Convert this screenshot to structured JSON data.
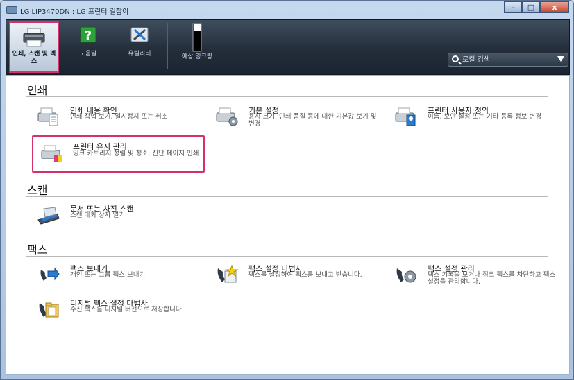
{
  "window": {
    "title": "LG LIP3470DN : LG 프린터 길잡이",
    "controls": {
      "minimize": "–",
      "maximize": "□",
      "close": "x"
    }
  },
  "toolbar": {
    "items": [
      {
        "label": "인쇄, 스캔 및 팩스",
        "icon": "printer-icon",
        "selected": true
      },
      {
        "label": "도움말",
        "icon": "help-icon",
        "selected": false
      },
      {
        "label": "유틸리티",
        "icon": "tools-icon",
        "selected": false
      },
      {
        "label": "예상 잉크량",
        "icon": "ink-level-icon",
        "selected": false
      }
    ],
    "search_placeholder": "로컬 검색"
  },
  "sections": {
    "print": {
      "title": "인쇄",
      "items": [
        {
          "name": "인쇄 내용 확인",
          "desc": "인쇄 작업 보기, 일시정지 또는 취소"
        },
        {
          "name": "기본 설정",
          "desc": "용지 크기, 인쇄 품질 등에 대한 기본값 보기 및 변경"
        },
        {
          "name": "프린터 사용자 정의",
          "desc": "이름, 보안 설정 또는 기타 등록 정보 변경"
        },
        {
          "name": "프린터 유지 관리",
          "desc": "잉크 카트리지 정렬 및 청소, 진단 페이지 인쇄"
        }
      ]
    },
    "scan": {
      "title": "스캔",
      "items": [
        {
          "name": "문서 또는 사진 스캔",
          "desc": "스캔 대화 상자 열기"
        }
      ]
    },
    "fax": {
      "title": "팩스",
      "items": [
        {
          "name": "팩스 보내기",
          "desc": "개인 또는 그룹 팩스 보내기"
        },
        {
          "name": "팩스 설정 마법사",
          "desc": "팩스를 설정하여 팩스를 보내고 받습니다."
        },
        {
          "name": "팩스 설정 관리",
          "desc": "팩스 기록을 보거나 정크 팩스를 차단하고 팩스 설정을 관리합니다."
        },
        {
          "name": "디지털 팩스 설정 마법사",
          "desc": "수신 팩스를 디지털 버전으로 저장합니다"
        }
      ]
    }
  },
  "colors": {
    "highlight": "#d6306a",
    "toolbar_bg": "#242e3a",
    "help_green": "#2ea23a"
  }
}
